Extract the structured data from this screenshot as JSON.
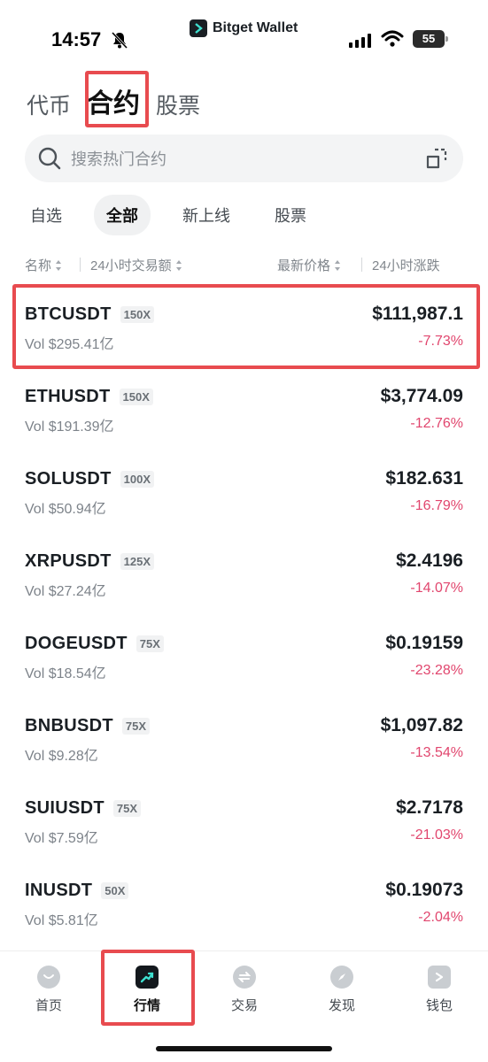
{
  "status_bar": {
    "time": "14:57",
    "brand": "Bitget Wallet",
    "battery": "55"
  },
  "top_tabs": [
    {
      "label": "代币",
      "active": false
    },
    {
      "label": "合约",
      "active": true
    },
    {
      "label": "股票",
      "active": false
    }
  ],
  "search": {
    "placeholder": "搜索热门合约"
  },
  "filters": [
    {
      "label": "自选",
      "active": false
    },
    {
      "label": "全部",
      "active": true
    },
    {
      "label": "新上线",
      "active": false
    },
    {
      "label": "股票",
      "active": false
    }
  ],
  "columns": {
    "name": "名称",
    "volume": "24小时交易额",
    "price": "最新价格",
    "change": "24小时涨跌"
  },
  "rows": [
    {
      "symbol": "BTCUSDT",
      "leverage": "150X",
      "volume": "Vol $295.41亿",
      "price": "$111,987.1",
      "change": "-7.73%"
    },
    {
      "symbol": "ETHUSDT",
      "leverage": "150X",
      "volume": "Vol $191.39亿",
      "price": "$3,774.09",
      "change": "-12.76%"
    },
    {
      "symbol": "SOLUSDT",
      "leverage": "100X",
      "volume": "Vol $50.94亿",
      "price": "$182.631",
      "change": "-16.79%"
    },
    {
      "symbol": "XRPUSDT",
      "leverage": "125X",
      "volume": "Vol $27.24亿",
      "price": "$2.4196",
      "change": "-14.07%"
    },
    {
      "symbol": "DOGEUSDT",
      "leverage": "75X",
      "volume": "Vol $18.54亿",
      "price": "$0.19159",
      "change": "-23.28%"
    },
    {
      "symbol": "BNBUSDT",
      "leverage": "75X",
      "volume": "Vol $9.28亿",
      "price": "$1,097.82",
      "change": "-13.54%"
    },
    {
      "symbol": "SUIUSDT",
      "leverage": "75X",
      "volume": "Vol $7.59亿",
      "price": "$2.7178",
      "change": "-21.03%"
    },
    {
      "symbol": "INUSDT",
      "leverage": "50X",
      "volume": "Vol $5.81亿",
      "price": "$0.19073",
      "change": "-2.04%"
    }
  ],
  "bottom_nav": [
    {
      "label": "首页",
      "icon": "home-icon",
      "active": false
    },
    {
      "label": "行情",
      "icon": "market-chart-icon",
      "active": true
    },
    {
      "label": "交易",
      "icon": "swap-icon",
      "active": false
    },
    {
      "label": "发现",
      "icon": "compass-icon",
      "active": false
    },
    {
      "label": "钱包",
      "icon": "wallet-icon",
      "active": false
    }
  ],
  "colors": {
    "highlight": "#e84b4f",
    "negative": "#e1466e",
    "text_primary": "#1a1f24"
  }
}
